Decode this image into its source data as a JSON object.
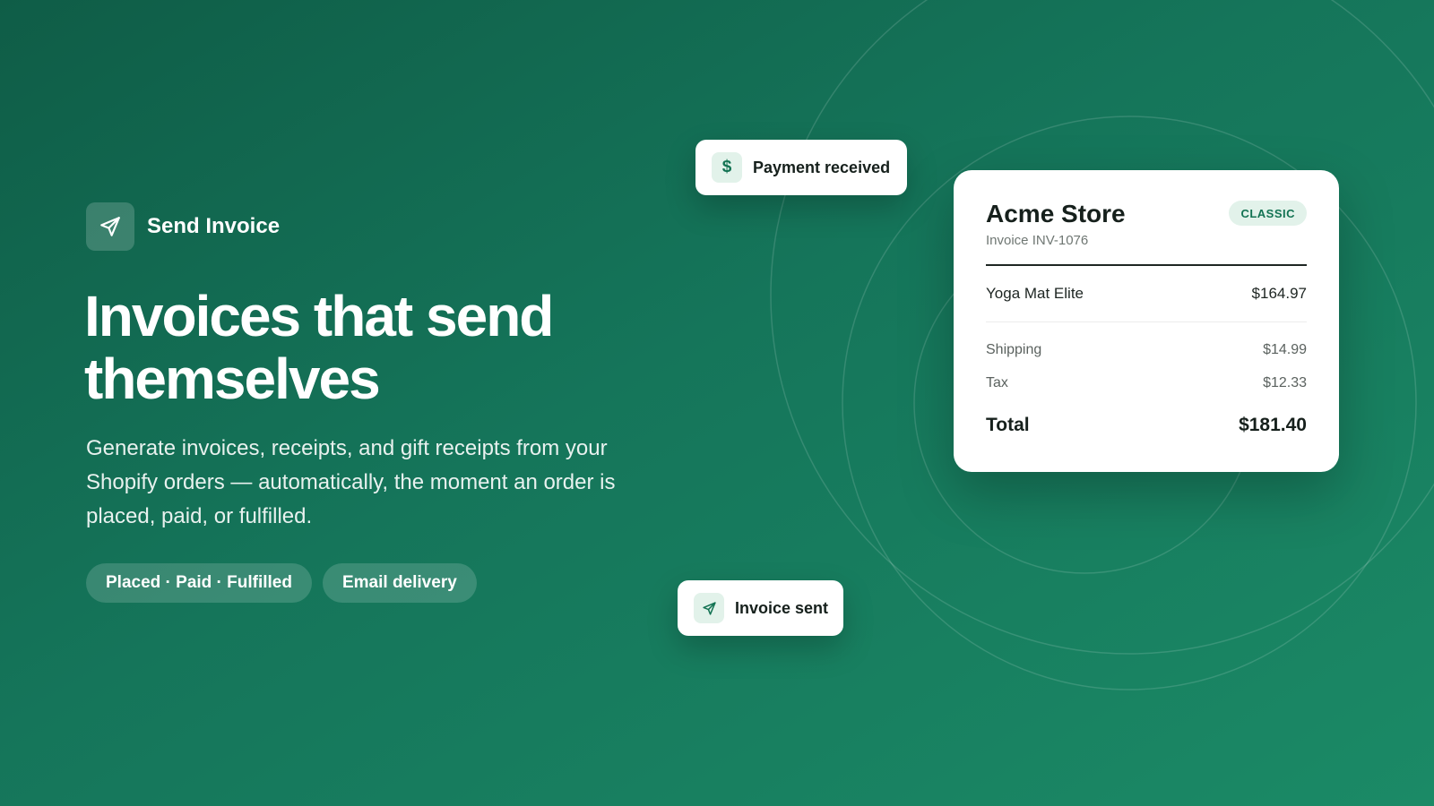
{
  "brand": {
    "name": "Send Invoice",
    "icon": "paper-plane-icon"
  },
  "hero": {
    "headline": "Invoices that send themselves",
    "subtext": "Generate invoices, receipts, and gift receipts from your Shopify orders — automatically, the moment an order is placed, paid, or fulfilled."
  },
  "pills": [
    {
      "label": "Placed · Paid · Fulfilled"
    },
    {
      "label": "Email delivery"
    }
  ],
  "toasts": {
    "payment": {
      "label": "Payment received",
      "icon_glyph": "$",
      "icon": "dollar-icon"
    },
    "sent": {
      "label": "Invoice sent",
      "icon": "paper-plane-icon"
    }
  },
  "invoice": {
    "store_name": "Acme Store",
    "invoice_number": "Invoice INV-1076",
    "template_badge": "CLASSIC",
    "line_items": [
      {
        "name": "Yoga Mat Elite",
        "amount": "$164.97"
      }
    ],
    "summary": [
      {
        "label": "Shipping",
        "amount": "$14.99"
      },
      {
        "label": "Tax",
        "amount": "$12.33"
      }
    ],
    "total_label": "Total",
    "total_amount": "$181.40"
  },
  "colors": {
    "background_start": "#0f5d47",
    "background_end": "#1b8a66",
    "accent": "#137353",
    "accent_soft": "#e2f2ea"
  }
}
